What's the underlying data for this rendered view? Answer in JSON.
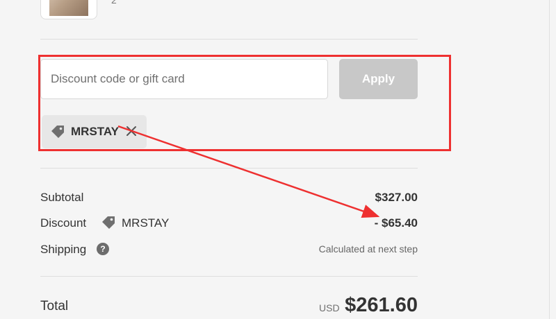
{
  "product": {
    "quantity_text": "2"
  },
  "discount_form": {
    "placeholder": "Discount code or gift card",
    "apply_label": "Apply",
    "applied_code": "MRSTAY"
  },
  "summary": {
    "subtotal_label": "Subtotal",
    "subtotal_value": "$327.00",
    "discount_label": "Discount",
    "discount_code": "MRSTAY",
    "discount_value": "- $65.40",
    "shipping_label": "Shipping",
    "shipping_help_icon": "?",
    "shipping_value": "Calculated at next step",
    "total_label": "Total",
    "currency": "USD",
    "total_value": "$261.60"
  },
  "icons": {
    "tag": "tag-icon",
    "remove": "close-icon",
    "help": "question-circle-icon"
  },
  "colors": {
    "annotation": "#ee3030",
    "apply_disabled": "#c8c8c8",
    "chip_bg": "#e7e7e7",
    "background": "#f5f5f5"
  }
}
